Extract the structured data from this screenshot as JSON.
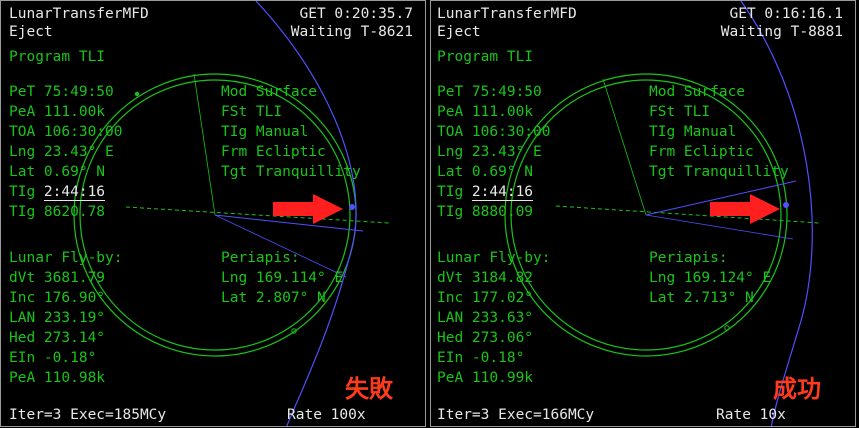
{
  "colors": {
    "text_white": "#e8e8e8",
    "text_green": "#19c419",
    "arrow_red": "#ff1f1f",
    "status_red": "#ff3b1e",
    "orbit_blue": "#5050ff"
  },
  "panels": [
    {
      "title": "LunarTransferMFD",
      "get": "GET 0:20:35.7",
      "mode": "Eject",
      "waiting": "Waiting T-8621",
      "program": "Program TLI",
      "pet": "PeT 75:49:50",
      "pea": "PeA 111.00k",
      "toa": "TOA 106:30:00",
      "lng": "Lng 23.43° E",
      "lat": "Lat 0.69° N",
      "tig_prefix": "TIg ",
      "tig_value": "2:44:16",
      "tig2": "TIg 8620.78",
      "mod": "Mod Surface",
      "fst": "FSt TLI",
      "tig_mode": "TIg Manual",
      "frm": "Frm Ecliptic",
      "tgt": "Tgt Tranquillity",
      "flyby_header": "Lunar Fly-by:",
      "dvt": "dVt 3681.79",
      "inc": "Inc 176.90°",
      "lan": "LAN 233.19°",
      "hed": "Hed 273.14°",
      "ein": "EIn -0.18°",
      "pea2": "PeA 110.98k",
      "periapsis_header": "Periapis:",
      "peri_lng": "Lng 169.114° E",
      "peri_lat": "Lat 2.807° N",
      "iter": "Iter=3 Exec=185MCy",
      "rate": "Rate 100x",
      "status": "失敗"
    },
    {
      "title": "LunarTransferMFD",
      "get": "GET 0:16:16.1",
      "mode": "Eject",
      "waiting": "Waiting T-8881",
      "program": "Program TLI",
      "pet": "PeT 75:49:50",
      "pea": "PeA 111.00k",
      "toa": "TOA 106:30:00",
      "lng": "Lng 23.43° E",
      "lat": "Lat 0.69° N",
      "tig_prefix": "TIg ",
      "tig_value": "2:44:16",
      "tig2": "TIg 8880.09",
      "mod": "Mod Surface",
      "fst": "FSt TLI",
      "tig_mode": "TIg Manual",
      "frm": "Frm Ecliptic",
      "tgt": "Tgt Tranquillity",
      "flyby_header": "Lunar Fly-by:",
      "dvt": "dVt 3184.82",
      "inc": "Inc 177.02°",
      "lan": "LAN 233.63°",
      "hed": "Hed 273.06°",
      "ein": "EIn -0.18°",
      "pea2": "PeA 110.99k",
      "periapsis_header": "Periapis:",
      "peri_lng": "Lng 169.124° E",
      "peri_lat": "Lat 2.713° N",
      "iter": "Iter=3 Exec=166MCy",
      "rate": "Rate 10x",
      "status": "成功"
    }
  ]
}
